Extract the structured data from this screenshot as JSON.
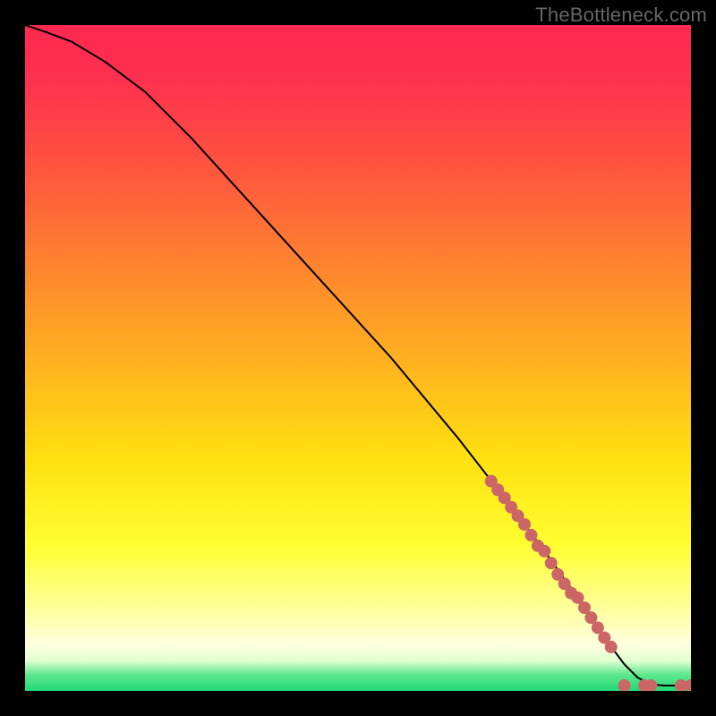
{
  "watermark": "TheBottleneck.com",
  "chart_data": {
    "type": "line",
    "title": "",
    "xlabel": "",
    "ylabel": "",
    "xlim": [
      0,
      100
    ],
    "ylim": [
      0,
      100
    ],
    "background_gradient": {
      "stops": [
        {
          "offset": 0.0,
          "color": "#ff2850"
        },
        {
          "offset": 0.08,
          "color": "#ff3050"
        },
        {
          "offset": 0.2,
          "color": "#ff5040"
        },
        {
          "offset": 0.35,
          "color": "#ff8030"
        },
        {
          "offset": 0.5,
          "color": "#ffb020"
        },
        {
          "offset": 0.65,
          "color": "#ffe010"
        },
        {
          "offset": 0.78,
          "color": "#ffff30"
        },
        {
          "offset": 0.88,
          "color": "#ffffa0"
        },
        {
          "offset": 0.93,
          "color": "#ffffe0"
        },
        {
          "offset": 0.955,
          "color": "#e0ffd0"
        },
        {
          "offset": 0.975,
          "color": "#60e890"
        },
        {
          "offset": 1.0,
          "color": "#20d878"
        }
      ]
    },
    "series": [
      {
        "name": "curve",
        "type": "line",
        "color": "#000000",
        "x": [
          0,
          3,
          7,
          12,
          18,
          25,
          35,
          45,
          55,
          65,
          72,
          78,
          83,
          87,
          90,
          92,
          94,
          96,
          98,
          100
        ],
        "y": [
          100,
          99,
          97.5,
          94.5,
          90,
          83,
          72,
          61,
          50,
          38,
          29,
          21,
          14,
          8,
          4,
          2,
          1,
          0.8,
          0.8,
          0.8
        ]
      },
      {
        "name": "markers-on-curve",
        "type": "scatter",
        "color": "#cc6666",
        "x": [
          70,
          71,
          72,
          73,
          74,
          75,
          76,
          77,
          78,
          79,
          80,
          81,
          82,
          83,
          84,
          85,
          86,
          87,
          88
        ],
        "y": [
          31.5,
          30.2,
          29.0,
          27.6,
          26.3,
          25.0,
          23.4,
          21.8,
          21.0,
          19.2,
          17.5,
          16.1,
          14.7,
          14.0,
          12.5,
          11.0,
          9.5,
          8.0,
          6.6
        ]
      },
      {
        "name": "markers-flat",
        "type": "scatter",
        "color": "#cc6666",
        "x": [
          90,
          93,
          94,
          98.5,
          100
        ],
        "y": [
          0.8,
          0.8,
          0.8,
          0.8,
          0.8
        ]
      }
    ]
  }
}
